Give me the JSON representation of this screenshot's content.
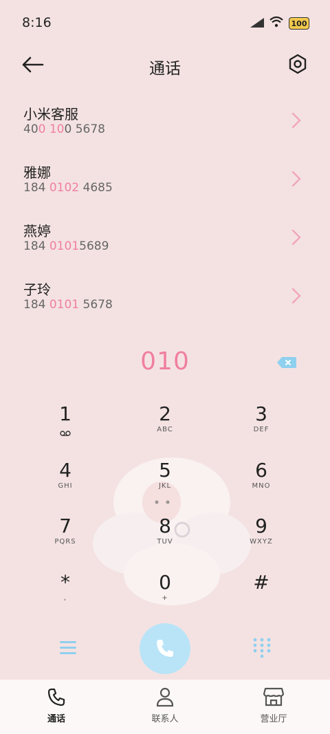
{
  "status": {
    "time": "8:16",
    "battery": "100"
  },
  "header": {
    "title": "通话"
  },
  "contacts": [
    {
      "name": "小米客服",
      "number": {
        "pre": "40",
        "match": "0 10",
        "post": "0 5678"
      }
    },
    {
      "name": "雅娜",
      "number": {
        "pre": "184 ",
        "match": "0102",
        "post": " 4685"
      }
    },
    {
      "name": "燕婷",
      "number": {
        "pre": "184 ",
        "match": "0101",
        "post": "5689"
      }
    },
    {
      "name": "子玲",
      "number": {
        "pre": "184 ",
        "match": "0101",
        "post": " 5678"
      }
    }
  ],
  "dialer": {
    "input": "010"
  },
  "keypad": [
    {
      "digit": "1",
      "letters": ""
    },
    {
      "digit": "2",
      "letters": "ABC"
    },
    {
      "digit": "3",
      "letters": "DEF"
    },
    {
      "digit": "4",
      "letters": "GHI"
    },
    {
      "digit": "5",
      "letters": "JKL"
    },
    {
      "digit": "6",
      "letters": "MNO"
    },
    {
      "digit": "7",
      "letters": "PQRS"
    },
    {
      "digit": "8",
      "letters": "TUV"
    },
    {
      "digit": "9",
      "letters": "WXYZ"
    },
    {
      "digit": "*",
      "letters": ","
    },
    {
      "digit": "0",
      "letters": "+"
    },
    {
      "digit": "#",
      "letters": ""
    }
  ],
  "tabs": [
    {
      "label": "通话",
      "icon": "phone-icon",
      "active": true
    },
    {
      "label": "联系人",
      "icon": "person-icon",
      "active": false
    },
    {
      "label": "营业厅",
      "icon": "store-icon",
      "active": false
    }
  ],
  "colors": {
    "accent": "#f07f9f",
    "call_button": "#b9e4f7",
    "icon_blue": "#8fd0ef"
  }
}
